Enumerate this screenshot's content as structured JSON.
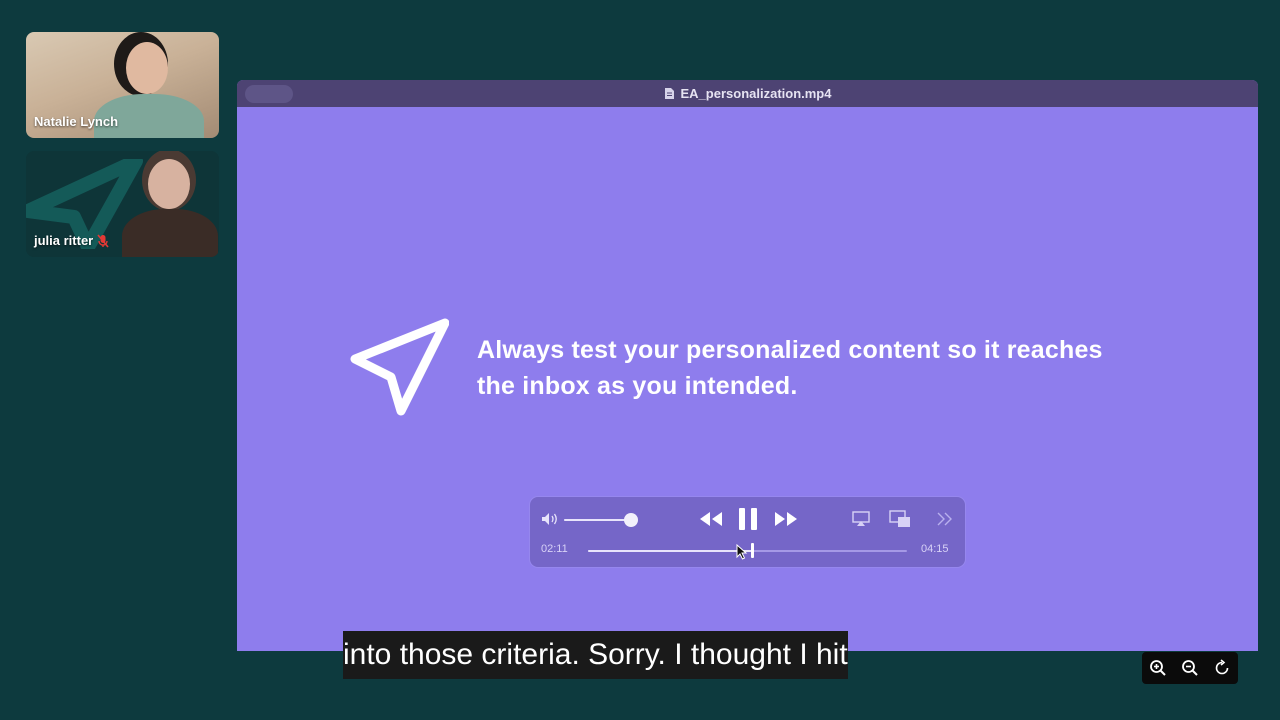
{
  "participants": [
    {
      "name": "Natalie Lynch",
      "muted": false
    },
    {
      "name": "julia ritter",
      "muted": true
    }
  ],
  "window": {
    "title": "EA_personalization.mp4"
  },
  "slide": {
    "text": "Always test your personalized content so it reaches the inbox as you intended.",
    "icon": "paper-plane-icon"
  },
  "player": {
    "current_time": "02:11",
    "total_time": "04:15",
    "progress": 0.514,
    "volume": 0.9
  },
  "caption": "into those criteria. Sorry. I thought I hit",
  "colors": {
    "background": "#0d3a3e",
    "slide": "#8e7ded",
    "titlebar": "#4d4373",
    "controls": "#7566c8"
  }
}
